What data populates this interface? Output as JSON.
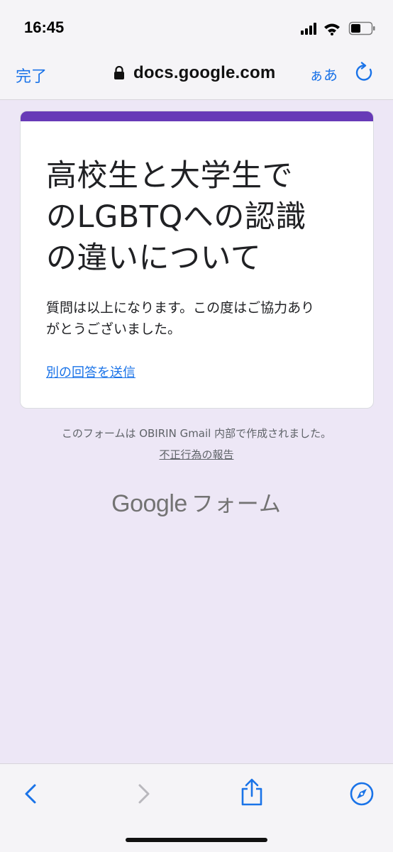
{
  "status_bar": {
    "time": "16:45"
  },
  "browser": {
    "done_label": "完了",
    "url": "docs.google.com",
    "text_size_label": "ぁあ"
  },
  "form": {
    "title": "高校生と大学生で\nのLGBTQへの認識\nの違いについて",
    "message": "質問は以上になります。この度はご協力あり\nがとうございました。",
    "another_response_link": "別の回答を送信"
  },
  "footer": {
    "note": "このフォームは OBIRIN Gmail 内部で作成されました。",
    "report_link": "不正行為の報告",
    "logo_google": "Google",
    "logo_forms": "フォーム"
  },
  "colors": {
    "accent": "#673ab7",
    "background": "#ede7f6",
    "link": "#1a73e8"
  },
  "icons": {
    "lock": "lock-icon",
    "reload": "reload-icon",
    "back": "back-arrow-icon",
    "forward": "forward-arrow-icon",
    "share": "share-icon",
    "compass": "compass-icon"
  }
}
